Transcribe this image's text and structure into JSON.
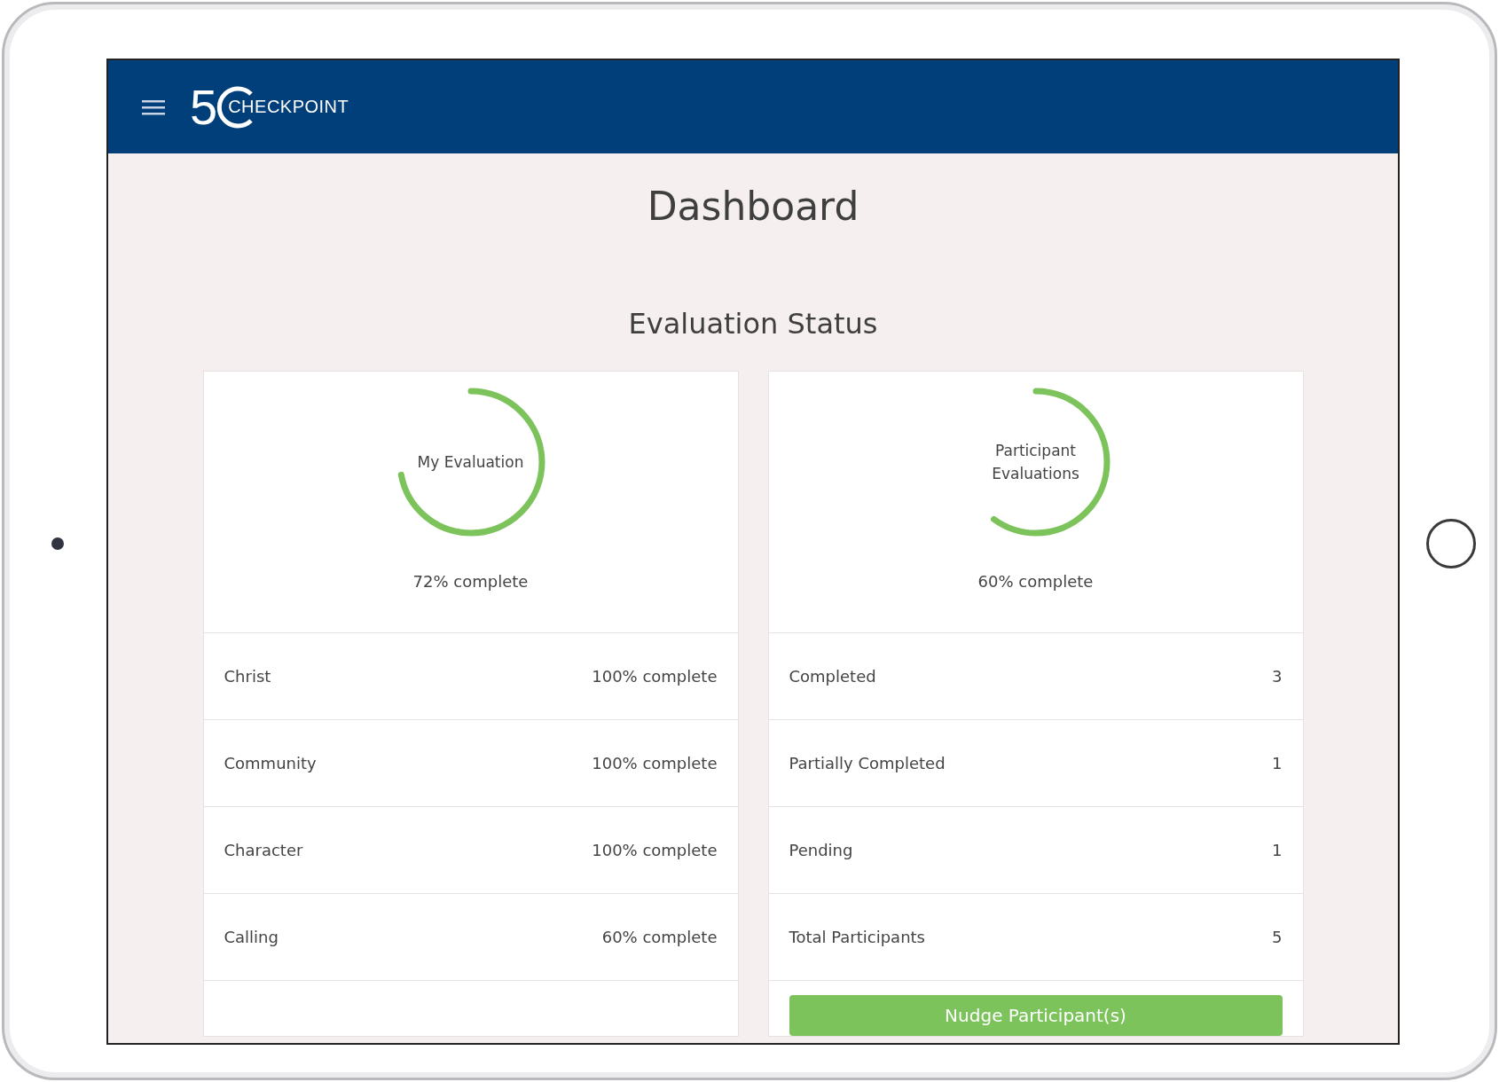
{
  "header": {
    "logo_number": "5",
    "logo_text": "CHECKPOINT"
  },
  "title": "Dashboard",
  "section_title": "Evaluation Status",
  "cards": [
    {
      "ring_label": "My Evaluation",
      "level": 0.72,
      "summary": "72% complete",
      "rows": [
        {
          "label": "Christ",
          "value": "100% complete"
        },
        {
          "label": "Community",
          "value": "100% complete"
        },
        {
          "label": "Character",
          "value": "100% complete"
        },
        {
          "label": "Calling",
          "value": "60% complete"
        }
      ]
    },
    {
      "ring_label": "Participant Evaluations",
      "level": 0.6,
      "summary": "60% complete",
      "rows": [
        {
          "label": "Completed",
          "value": "3"
        },
        {
          "label": "Partially Completed",
          "value": "1"
        },
        {
          "label": "Pending",
          "value": "1"
        },
        {
          "label": "Total Participants",
          "value": "5"
        }
      ],
      "button": "Nudge Participant(s)"
    }
  ]
}
